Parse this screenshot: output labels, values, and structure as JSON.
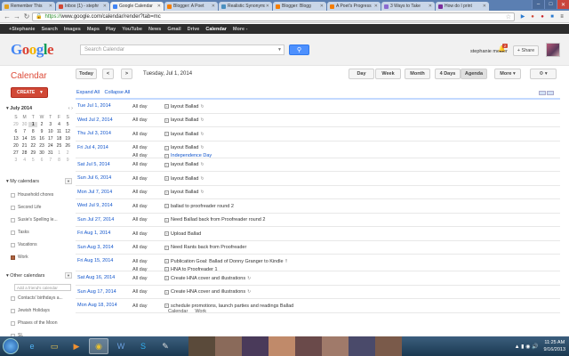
{
  "browser": {
    "tabs": [
      {
        "label": "Remember This",
        "color": "#e0a020",
        "active": false
      },
      {
        "label": "Inbox (1) - stephr",
        "color": "#d14836",
        "active": false
      },
      {
        "label": "Google Calendar",
        "color": "#4285f4",
        "active": true
      },
      {
        "label": "Blogger: A Poet",
        "color": "#f57d00",
        "active": false
      },
      {
        "label": "Realistic Synonyms",
        "color": "#4a90c0",
        "active": false
      },
      {
        "label": "Blogger: Blogg",
        "color": "#f57d00",
        "active": false
      },
      {
        "label": "A Poet's Progress",
        "color": "#f57d00",
        "active": false
      },
      {
        "label": "3 Ways to Take",
        "color": "#8a6ad0",
        "active": false
      },
      {
        "label": "How do I print",
        "color": "#7b2d9c",
        "active": false
      }
    ],
    "url_https": "https://",
    "url_rest": "www.google.com/calendar/render?tab=mc"
  },
  "gbar": {
    "items": [
      "+Stephanie",
      "Search",
      "Images",
      "Maps",
      "Play",
      "YouTube",
      "News",
      "Gmail",
      "Drive",
      "Calendar",
      "More -"
    ],
    "active": "Calendar"
  },
  "header": {
    "logo_letters": [
      {
        "ch": "G",
        "color": "#4285f4"
      },
      {
        "ch": "o",
        "color": "#db4437"
      },
      {
        "ch": "o",
        "color": "#f4b400"
      },
      {
        "ch": "g",
        "color": "#4285f4"
      },
      {
        "ch": "l",
        "color": "#0f9d58"
      },
      {
        "ch": "e",
        "color": "#db4437"
      }
    ],
    "search_placeholder": "Search Calendar",
    "username": "stephanie mesler",
    "notif_count": "2",
    "share_label": "+ Share"
  },
  "toolbar": {
    "app_title": "Calendar",
    "today": "Today",
    "prev": "<",
    "next": ">",
    "date": "Tuesday, Jul 1, 2014",
    "views": [
      "Day",
      "Week",
      "Month",
      "4 Days",
      "Agenda"
    ],
    "selected_view": "Agenda",
    "more": "More",
    "settings": "⚙"
  },
  "sidebar": {
    "create_label": "CREATE",
    "month_label": "July 2014",
    "dow": [
      "S",
      "M",
      "T",
      "W",
      "T",
      "F",
      "S"
    ],
    "weeks": [
      [
        "29",
        "30",
        "1",
        "2",
        "3",
        "4",
        "5"
      ],
      [
        "6",
        "7",
        "8",
        "9",
        "10",
        "11",
        "12"
      ],
      [
        "13",
        "14",
        "15",
        "16",
        "17",
        "18",
        "19"
      ],
      [
        "20",
        "21",
        "22",
        "23",
        "24",
        "25",
        "26"
      ],
      [
        "27",
        "28",
        "29",
        "30",
        "31",
        "1",
        "2"
      ],
      [
        "3",
        "4",
        "5",
        "6",
        "7",
        "8",
        "9"
      ]
    ],
    "my_calendars_label": "My calendars",
    "my_calendars": [
      {
        "name": "Household chores",
        "on": false
      },
      {
        "name": "Second Life",
        "on": false
      },
      {
        "name": "Susie's Spelling le...",
        "on": false
      },
      {
        "name": "Tasks",
        "on": false
      },
      {
        "name": "Vacations",
        "on": false
      },
      {
        "name": "Work",
        "on": true
      }
    ],
    "other_calendars_label": "Other calendars",
    "add_friend_placeholder": "Add a friend's calendar",
    "other_calendars": [
      {
        "name": "Contacts' birthdays a...",
        "on": false
      },
      {
        "name": "Jewish Holidays",
        "on": false
      },
      {
        "name": "Phases of the Moon",
        "on": false
      },
      {
        "name": "SL",
        "on": false
      }
    ]
  },
  "agenda": {
    "expand_all": "Expand All",
    "collapse_all": "Collapse All",
    "rows": [
      {
        "date": "Tue Jul 1, 2014",
        "events": [
          {
            "time": "All day",
            "name": "layout Ballad",
            "badge": "↻",
            "blue": false
          }
        ]
      },
      {
        "date": "Wed Jul 2, 2014",
        "events": [
          {
            "time": "All day",
            "name": "layout Ballad",
            "badge": "↻",
            "blue": false
          }
        ]
      },
      {
        "date": "Thu Jul 3, 2014",
        "events": [
          {
            "time": "All day",
            "name": "layout Ballad",
            "badge": "↻",
            "blue": false
          }
        ]
      },
      {
        "date": "Fri Jul 4, 2014",
        "events": [
          {
            "time": "All day",
            "name": "layout Ballad",
            "badge": "↻",
            "blue": false
          },
          {
            "time": "All day",
            "name": "Independence Day",
            "badge": "",
            "blue": true
          }
        ]
      },
      {
        "date": "Sat Jul 5, 2014",
        "events": [
          {
            "time": "All day",
            "name": "layout Ballad",
            "badge": "↻",
            "blue": false
          }
        ]
      },
      {
        "date": "Sun Jul 6, 2014",
        "events": [
          {
            "time": "All day",
            "name": "layout Ballad",
            "badge": "↻",
            "blue": false
          }
        ]
      },
      {
        "date": "Mon Jul 7, 2014",
        "events": [
          {
            "time": "All day",
            "name": "layout Ballad",
            "badge": "↻",
            "blue": false
          }
        ]
      },
      {
        "date": "Wed Jul 9, 2014",
        "events": [
          {
            "time": "All day",
            "name": "ballad to proofreader round 2",
            "badge": "",
            "blue": false
          }
        ]
      },
      {
        "date": "Sun Jul 27, 2014",
        "events": [
          {
            "time": "All day",
            "name": "Need Ballad back from Proofreader round 2",
            "badge": "",
            "blue": false
          }
        ]
      },
      {
        "date": "Fri Aug 1, 2014",
        "events": [
          {
            "time": "All day",
            "name": "Upload Ballad",
            "badge": "",
            "blue": false
          }
        ]
      },
      {
        "date": "Sun Aug 3, 2014",
        "events": [
          {
            "time": "All day",
            "name": "Need Rants back from Proofreader",
            "badge": "",
            "blue": false
          }
        ]
      },
      {
        "date": "Fri Aug 15, 2014",
        "events": [
          {
            "time": "All day",
            "name": "Publication Goal: Ballad of Donny Granger to Kindle",
            "badge": "‼",
            "blue": false
          },
          {
            "time": "All day",
            "name": "HNA to Proofreader 1",
            "badge": "",
            "blue": false
          }
        ]
      },
      {
        "date": "Sat Aug 16, 2014",
        "events": [
          {
            "time": "All day",
            "name": "Create HNA cover and illustrations",
            "badge": "↻",
            "blue": false
          }
        ]
      },
      {
        "date": "Sun Aug 17, 2014",
        "events": [
          {
            "time": "All day",
            "name": "Create HNA cover and illustrations",
            "badge": "↻",
            "blue": false
          }
        ]
      },
      {
        "date": "Mon Aug 18, 2014",
        "events": [
          {
            "time": "All day",
            "name": "schedule promotions, launch parties and readings Ballad",
            "badge": "",
            "blue": false
          }
        ],
        "sub": [
          "Calendar",
          "Work"
        ]
      }
    ]
  },
  "taskbar": {
    "time": "11:25 AM",
    "date": "9/16/2013"
  }
}
